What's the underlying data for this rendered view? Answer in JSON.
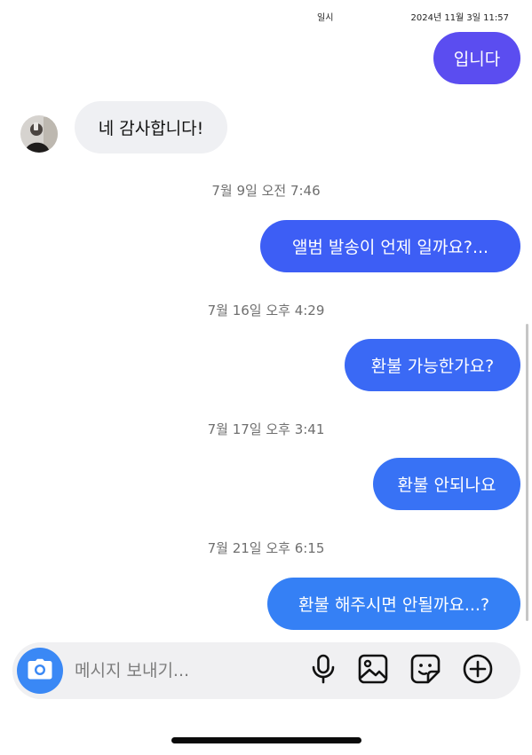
{
  "status_bar": {
    "center_text": "일시",
    "right_text": "2024년 11월 3일 11:57"
  },
  "messages": [
    {
      "kind": "outgoing",
      "text": "입니다",
      "color": "#5b4df0"
    },
    {
      "kind": "incoming",
      "text": "네 감사합니다!"
    },
    {
      "kind": "timestamp",
      "text": "7월 9일 오전 7:46"
    },
    {
      "kind": "outgoing",
      "text": "앨범 발송이 언제 일까요?...",
      "color": "#3d5ef5"
    },
    {
      "kind": "timestamp",
      "text": "7월 16일 오후 4:29"
    },
    {
      "kind": "outgoing",
      "text": "환불 가능한가요?",
      "color": "#3a69f5"
    },
    {
      "kind": "timestamp",
      "text": "7월 17일 오후 3:41"
    },
    {
      "kind": "outgoing",
      "text": "환불 안되나요",
      "color": "#3872f5"
    },
    {
      "kind": "timestamp",
      "text": "7월 21일 오후 6:15"
    },
    {
      "kind": "outgoing",
      "text": "환불 해주시면 안될까요...?",
      "color": "#3580f5"
    }
  ],
  "composer": {
    "placeholder": "메시지 보내기...",
    "camera_icon": "camera-icon",
    "icons": [
      "microphone-icon",
      "image-icon",
      "sticker-icon",
      "plus-circle-icon"
    ],
    "accent_color": "#3a88f5"
  }
}
